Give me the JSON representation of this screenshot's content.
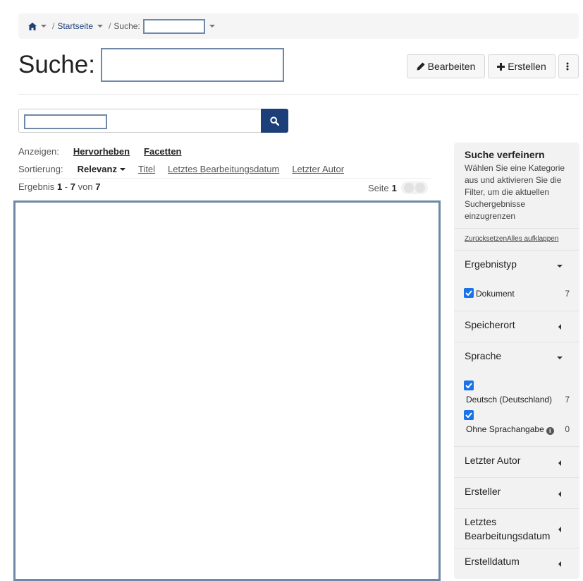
{
  "breadcrumb": {
    "home_icon": "home-icon",
    "items": [
      "Startseite"
    ],
    "search_label": "Suche:"
  },
  "title": {
    "text": "Suche:"
  },
  "toolbar": {
    "edit_label": "Bearbeiten",
    "create_label": "Erstellen",
    "more_icon": "vertical-dots-icon"
  },
  "search": {
    "button_icon": "search-icon"
  },
  "display": {
    "label": "Anzeigen:",
    "options": [
      "Hervorheben",
      "Facetten"
    ]
  },
  "sort": {
    "label": "Sortierung:",
    "active": "Relevanz",
    "options": [
      "Titel",
      "Letztes Bearbeitungsdatum",
      "Letzter Autor"
    ]
  },
  "results": {
    "prefix": "Ergebnis",
    "from": "1",
    "dash": "-",
    "to": "7",
    "of": "von",
    "total": "7",
    "page_label": "Seite",
    "page": "1"
  },
  "refine": {
    "title": "Suche verfeinern",
    "description": "Wählen Sie eine Kategorie aus und aktivieren Sie die Filter, um die aktuellen Suchergebnisse einzugrenzen",
    "reset": "Zurücksetzen",
    "expand_all": "Alles aufklappen",
    "facets": [
      {
        "title": "Ergebnistyp",
        "expanded": true,
        "options": [
          {
            "label": "Dokument",
            "count": "7",
            "checked": true
          }
        ]
      },
      {
        "title": "Speicherort",
        "expanded": false
      },
      {
        "title": "Sprache",
        "expanded": true,
        "options": [
          {
            "label": "Deutsch (Deutschland)",
            "count": "7",
            "checked": true
          },
          {
            "label": "Ohne Sprachangabe",
            "count": "0",
            "checked": true
          }
        ]
      },
      {
        "title": "Letzter Autor",
        "expanded": false
      },
      {
        "title": "Ersteller",
        "expanded": false
      },
      {
        "title": "Letztes Bearbeitungsdatum",
        "expanded": false
      },
      {
        "title": "Erstelldatum",
        "expanded": false
      }
    ]
  },
  "colors": {
    "accent": "#1c3f7a",
    "checkbox": "#1a73e8",
    "redaction": "#6f88a8"
  }
}
